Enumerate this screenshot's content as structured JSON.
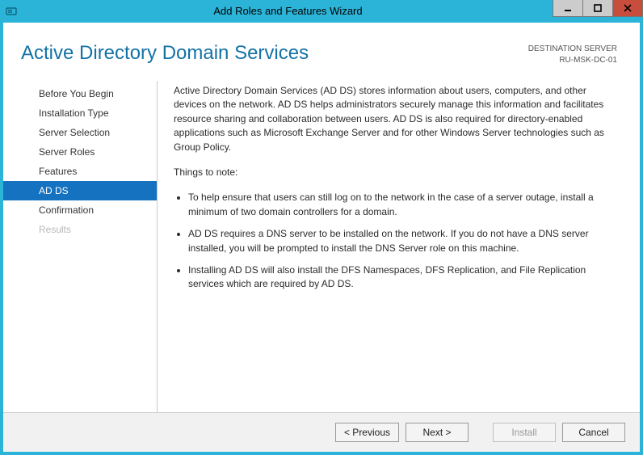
{
  "titlebar": {
    "title": "Add Roles and Features Wizard"
  },
  "header": {
    "title": "Active Directory Domain Services",
    "destination_label": "DESTINATION SERVER",
    "destination_value": "RU-MSK-DC-01"
  },
  "sidebar": {
    "steps": [
      {
        "label": "Before You Begin",
        "active": false,
        "disabled": false
      },
      {
        "label": "Installation Type",
        "active": false,
        "disabled": false
      },
      {
        "label": "Server Selection",
        "active": false,
        "disabled": false
      },
      {
        "label": "Server Roles",
        "active": false,
        "disabled": false
      },
      {
        "label": "Features",
        "active": false,
        "disabled": false
      },
      {
        "label": "AD DS",
        "active": true,
        "disabled": false
      },
      {
        "label": "Confirmation",
        "active": false,
        "disabled": false
      },
      {
        "label": "Results",
        "active": false,
        "disabled": true
      }
    ]
  },
  "content": {
    "intro": "Active Directory Domain Services (AD DS) stores information about users, computers, and other devices on the network.  AD DS helps administrators securely manage this information and facilitates resource sharing and collaboration between users.  AD DS is also required for directory-enabled applications such as Microsoft Exchange Server and for other Windows Server technologies such as Group Policy.",
    "note_heading": "Things to note:",
    "notes": [
      "To help ensure that users can still log on to the network in the case of a server outage, install a minimum of two domain controllers for a domain.",
      "AD DS requires a DNS server to be installed on the network.  If you do not have a DNS server installed, you will be prompted to install the DNS Server role on this machine.",
      "Installing AD DS will also install the DFS Namespaces, DFS Replication, and File Replication services which are required by AD DS."
    ]
  },
  "footer": {
    "previous": "< Previous",
    "next": "Next >",
    "install": "Install",
    "cancel": "Cancel"
  }
}
